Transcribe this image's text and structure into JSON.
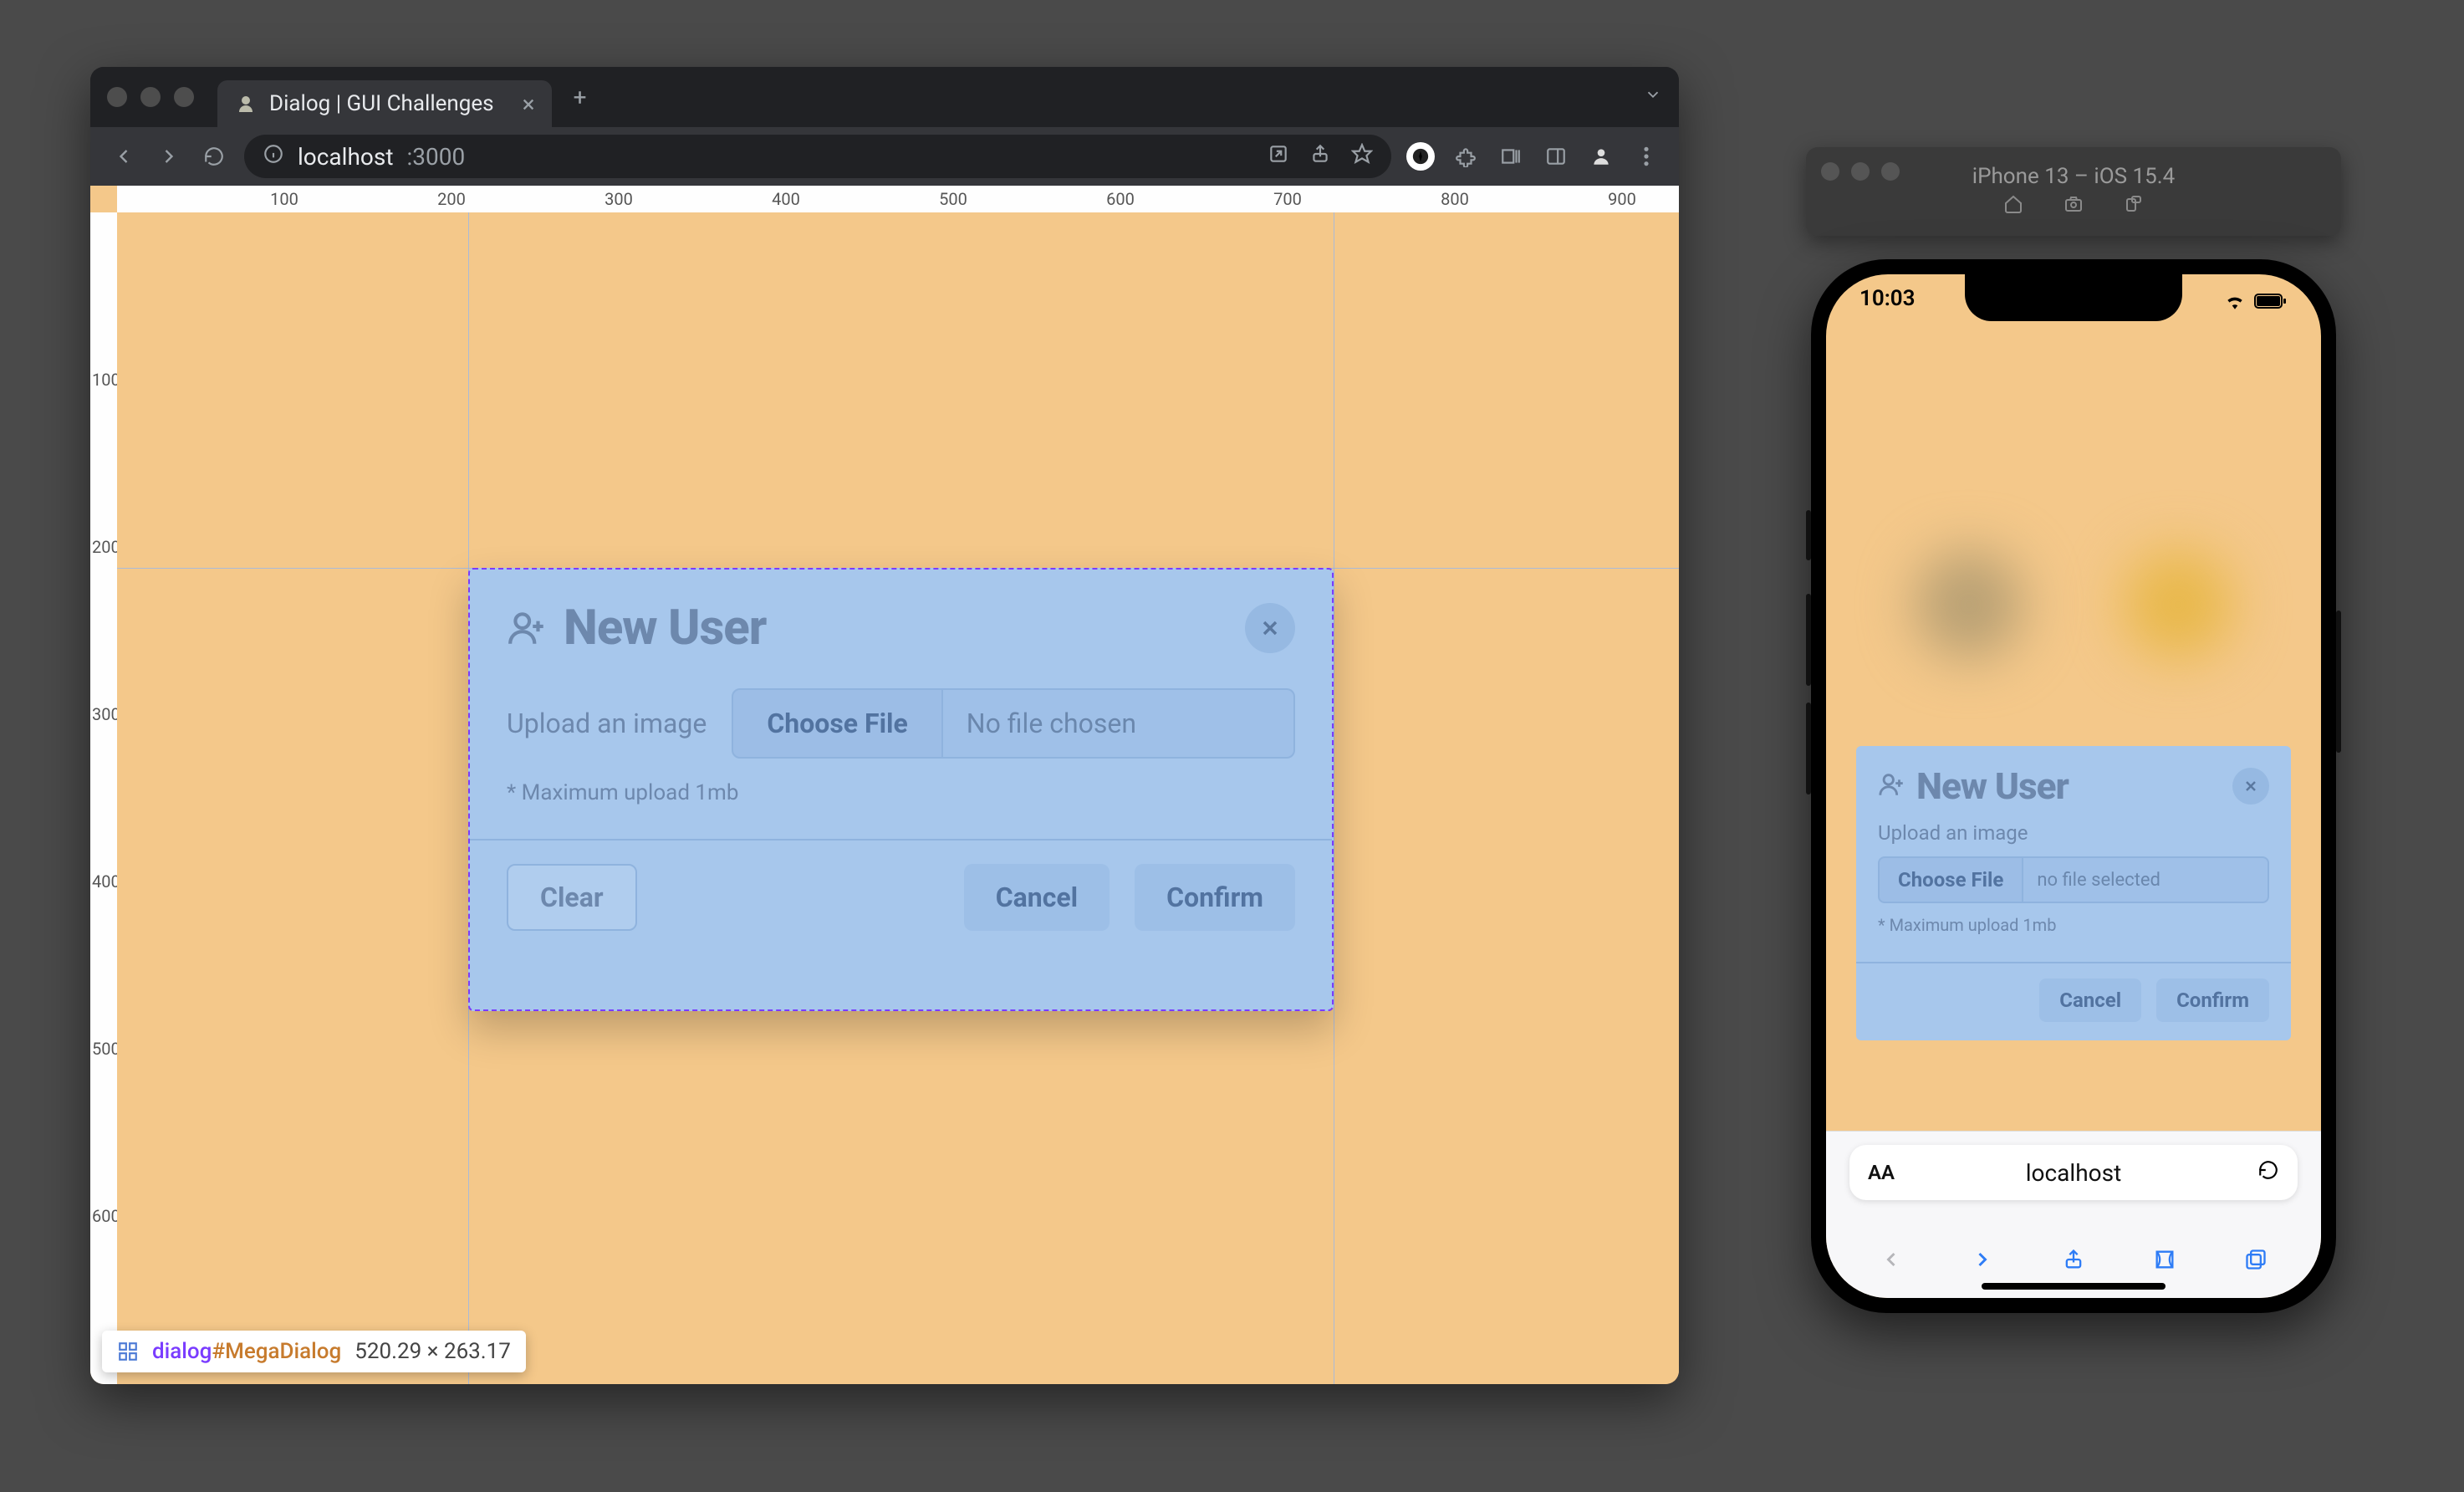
{
  "browser": {
    "tab_title": "Dialog | GUI Challenges",
    "url_host": "localhost",
    "url_port": ":3000"
  },
  "rulers": {
    "h": [
      "100",
      "200",
      "300",
      "400",
      "500",
      "600",
      "700",
      "800",
      "900"
    ],
    "v": [
      "100",
      "200",
      "300",
      "400",
      "500",
      "600"
    ]
  },
  "dialog": {
    "title": "New User",
    "upload_label": "Upload an image",
    "choose_file": "Choose File",
    "no_file": "No file chosen",
    "hint": "* Maximum upload 1mb",
    "clear": "Clear",
    "cancel": "Cancel",
    "confirm": "Confirm"
  },
  "devtools_badge": {
    "tag": "dialog",
    "id": "#MegaDialog",
    "dims": "520.29 × 263.17"
  },
  "simulator": {
    "title": "iPhone 13 – iOS 15.4"
  },
  "phone": {
    "time": "10:03",
    "url": "localhost",
    "dialog": {
      "title": "New User",
      "upload_label": "Upload an image",
      "choose_file": "Choose File",
      "no_file": "no file selected",
      "hint": "* Maximum upload 1mb",
      "cancel": "Cancel",
      "confirm": "Confirm"
    }
  }
}
